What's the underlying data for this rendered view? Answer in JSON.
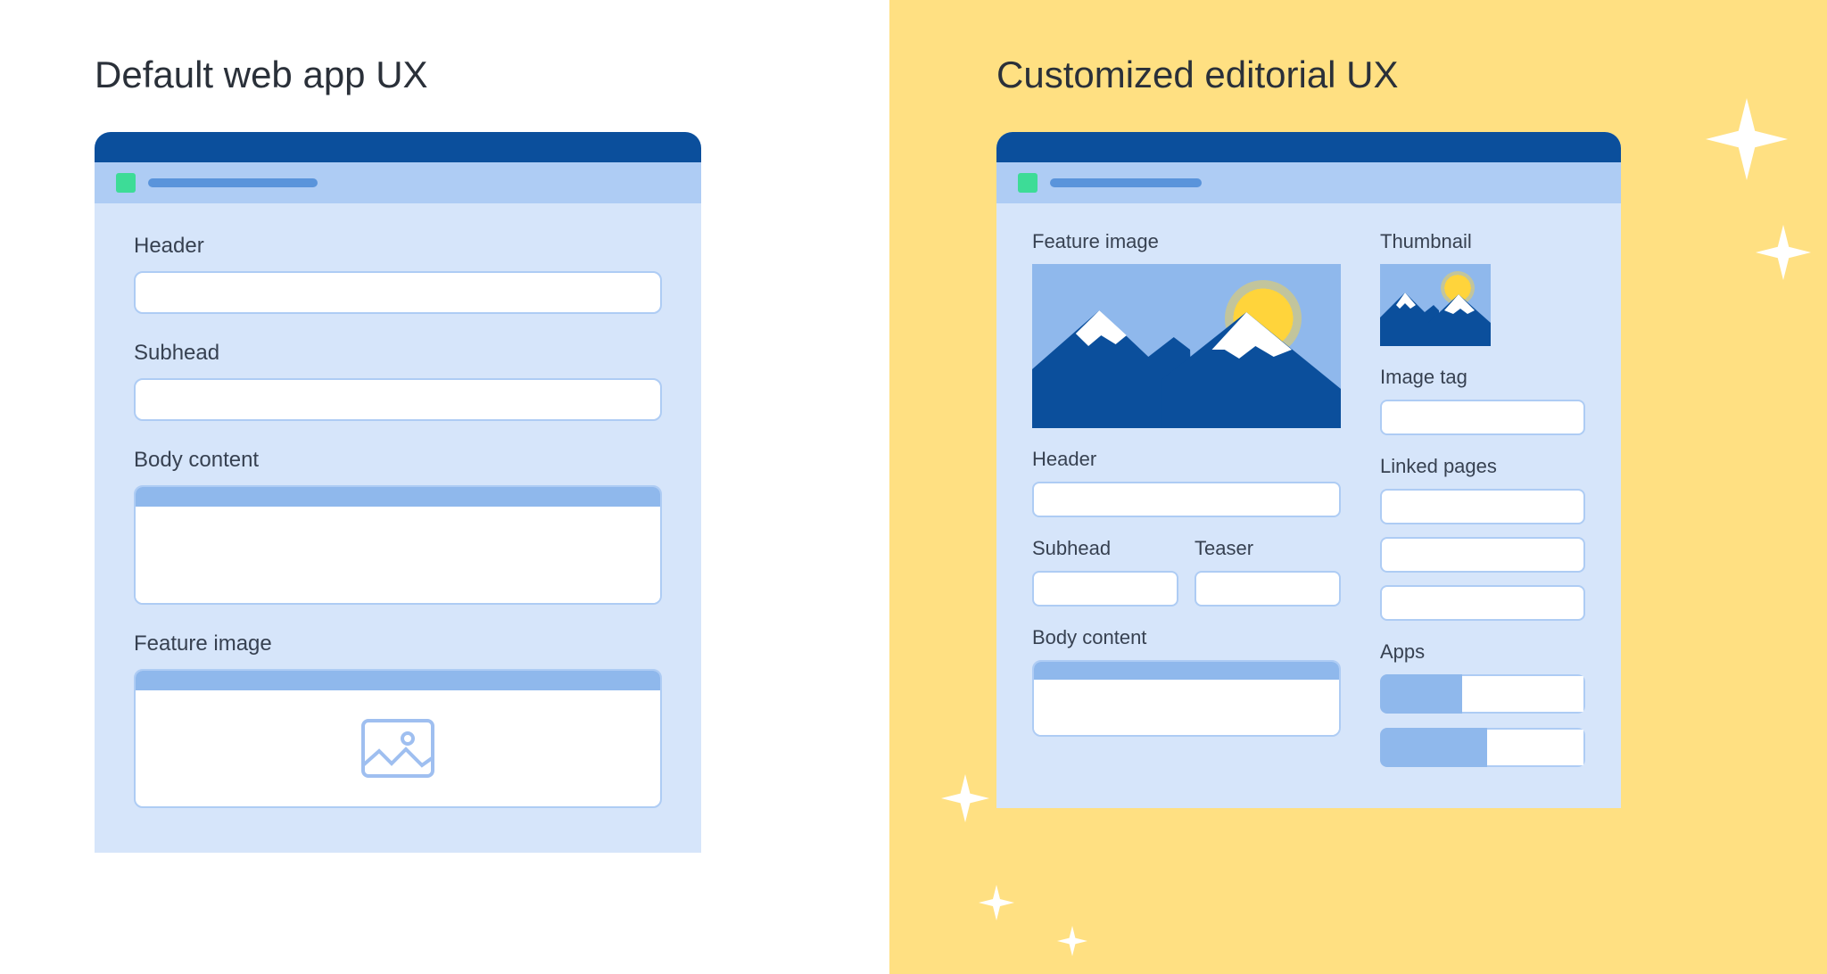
{
  "left": {
    "title": "Default web app UX",
    "fields": {
      "header": "Header",
      "subhead": "Subhead",
      "body": "Body content",
      "feature_image": "Feature image"
    }
  },
  "right": {
    "title": "Customized editorial UX",
    "fields": {
      "feature_image": "Feature image",
      "header": "Header",
      "subhead": "Subhead",
      "teaser": "Teaser",
      "body": "Body content",
      "thumbnail": "Thumbnail",
      "image_tag": "Image tag",
      "linked_pages": "Linked pages",
      "apps": "Apps"
    }
  }
}
